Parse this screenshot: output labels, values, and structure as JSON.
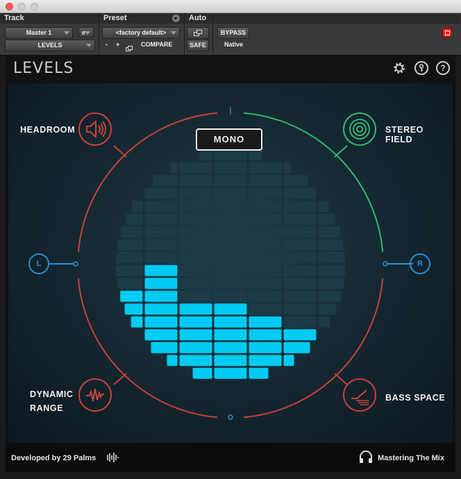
{
  "window": {},
  "header": {
    "track_label": "Track",
    "preset_label": "Preset",
    "auto_label": "Auto",
    "track_name": "Master 1",
    "track_e": "e",
    "plugin_select": "LEVELS",
    "preset_name": "<factory default>",
    "preset_minus": "-",
    "preset_plus": "+",
    "compare_label": "COMPARE",
    "safe_label": "SAFE",
    "bypass_label": "BYPASS",
    "native_label": "Native"
  },
  "plugin": {
    "title": "LEVELS",
    "help_label": "?",
    "mono_label": "MONO",
    "headroom_label": "HEADROOM",
    "stereo_field_label": "STEREO FIELD",
    "dynamic_range_label_1": "DYNAMIC",
    "dynamic_range_label_2": "RANGE",
    "bass_space_label": "BASS SPACE",
    "left_label": "L",
    "right_label": "R",
    "footer_left": "Developed by 29 Palms",
    "footer_right": "Mastering The Mix"
  },
  "colors": {
    "headroom": "#c8433a",
    "stereo": "#2fb86e",
    "balance": "#2b8fcf",
    "cell_off": "#1d3b47",
    "cell_on": "#00cbf2"
  },
  "meter": {
    "column_lit_levels": [
      2,
      7,
      9,
      6,
      6,
      5,
      4,
      3,
      2
    ]
  }
}
